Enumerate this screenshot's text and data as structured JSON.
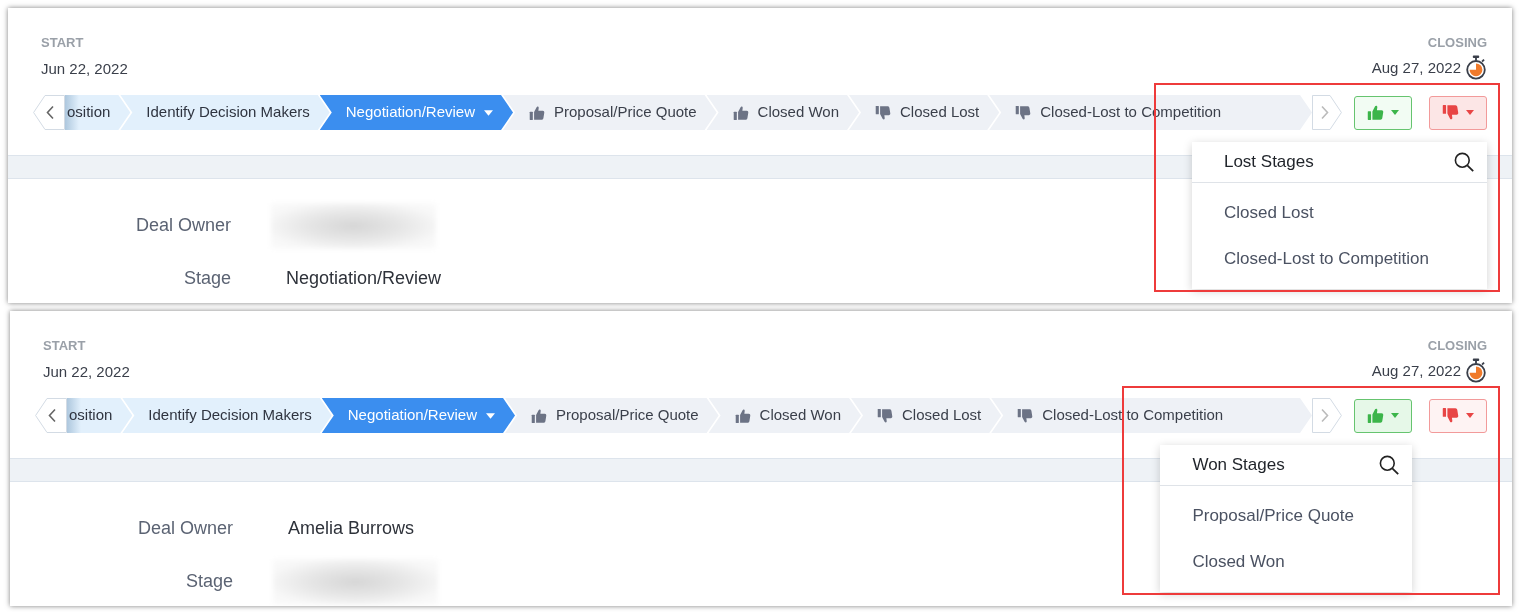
{
  "panels": [
    {
      "highlighted": true,
      "start": {
        "label": "START",
        "date": "Jun 22, 2022"
      },
      "closing": {
        "label": "CLOSING",
        "date": "Aug 27, 2022"
      },
      "stages": [
        {
          "label": "osition",
          "kind": "open",
          "completed": true,
          "selected": false
        },
        {
          "label": "Identify Decision Makers",
          "kind": "open",
          "completed": true,
          "selected": false
        },
        {
          "label": "Negotiation/Review",
          "kind": "open",
          "completed": false,
          "selected": true
        },
        {
          "label": "Proposal/Price Quote",
          "kind": "won",
          "completed": false,
          "selected": false
        },
        {
          "label": "Closed Won",
          "kind": "won",
          "completed": false,
          "selected": false
        },
        {
          "label": "Closed Lost",
          "kind": "lost",
          "completed": false,
          "selected": false
        },
        {
          "label": "Closed-Lost to Competition",
          "kind": "lost",
          "completed": false,
          "selected": false
        }
      ],
      "outcome_buttons": [
        {
          "kind": "won",
          "expanded": false
        },
        {
          "kind": "lost",
          "expanded": true,
          "menu": {
            "title": "Lost Stages",
            "items": [
              "Closed Lost",
              "Closed-Lost to Competition"
            ]
          }
        }
      ],
      "details": [
        {
          "label": "Deal Owner",
          "redacted": true
        },
        {
          "label": "Stage",
          "value": "Negotiation/Review",
          "redacted": false
        }
      ]
    },
    {
      "highlighted": true,
      "start": {
        "label": "START",
        "date": "Jun 22, 2022"
      },
      "closing": {
        "label": "CLOSING",
        "date": "Aug 27, 2022"
      },
      "stages": [
        {
          "label": "osition",
          "kind": "open",
          "completed": true,
          "selected": false
        },
        {
          "label": "Identify Decision Makers",
          "kind": "open",
          "completed": true,
          "selected": false
        },
        {
          "label": "Negotiation/Review",
          "kind": "open",
          "completed": false,
          "selected": true
        },
        {
          "label": "Proposal/Price Quote",
          "kind": "won",
          "completed": false,
          "selected": false
        },
        {
          "label": "Closed Won",
          "kind": "won",
          "completed": false,
          "selected": false
        },
        {
          "label": "Closed Lost",
          "kind": "lost",
          "completed": false,
          "selected": false
        },
        {
          "label": "Closed-Lost to Competition",
          "kind": "lost",
          "completed": false,
          "selected": false
        }
      ],
      "outcome_buttons": [
        {
          "kind": "won",
          "expanded": true,
          "menu": {
            "title": "Won Stages",
            "items": [
              "Proposal/Price Quote",
              "Closed Won"
            ]
          }
        },
        {
          "kind": "lost",
          "expanded": false
        }
      ],
      "details": [
        {
          "label": "Deal Owner",
          "value": "Amelia Burrows",
          "redacted": false
        },
        {
          "label": "Stage",
          "redacted": true
        }
      ]
    }
  ]
}
